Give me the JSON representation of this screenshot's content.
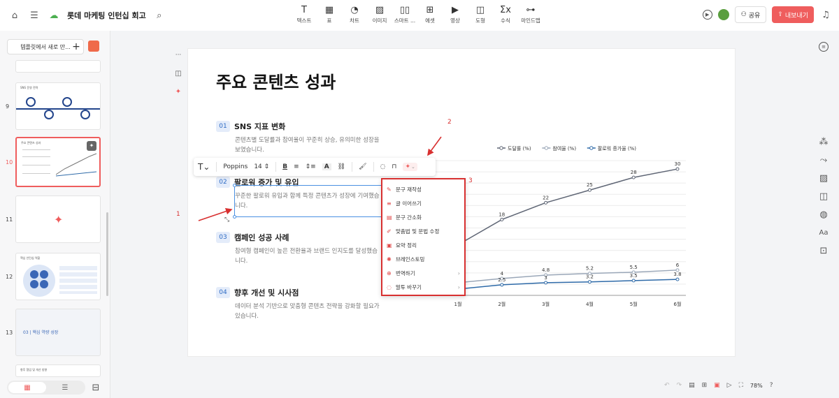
{
  "header": {
    "doc_title": "롯데 마케팅 인턴십 회고",
    "icons": [
      "home-icon",
      "menu-icon",
      "cloud-icon",
      "search-icon"
    ]
  },
  "toolbar": {
    "tools": [
      {
        "label": "텍스트",
        "icon": "T",
        "name": "tool-text"
      },
      {
        "label": "표",
        "icon": "▦",
        "name": "tool-table"
      },
      {
        "label": "차트",
        "icon": "◔",
        "name": "tool-chart"
      },
      {
        "label": "이미지",
        "icon": "▨",
        "name": "tool-image"
      },
      {
        "label": "스마트 ...",
        "icon": "▯▯",
        "name": "tool-smart"
      },
      {
        "label": "에셋",
        "icon": "⊞",
        "name": "tool-asset"
      },
      {
        "label": "영상",
        "icon": "▶",
        "name": "tool-video"
      },
      {
        "label": "도형",
        "icon": "◫",
        "name": "tool-shape"
      },
      {
        "label": "수식",
        "icon": "Σx",
        "name": "tool-formula"
      },
      {
        "label": "마인드맵",
        "icon": "⊶",
        "name": "tool-mindmap"
      }
    ],
    "share_label": "공유",
    "export_label": "내보내기"
  },
  "sidebar": {
    "template_button": "템플릿에서 새로 만...",
    "thumbs": [
      {
        "num": "9",
        "title": "SNS 운영 전략"
      },
      {
        "num": "10",
        "title": "주요 콘텐츠 성과"
      },
      {
        "num": "11",
        "title": ""
      },
      {
        "num": "12",
        "title": "핵심 인턴십 역할"
      },
      {
        "num": "13",
        "title": "03 | 핵심 역량 성장"
      },
      {
        "num": "",
        "title": "향후 협업 및 개선 방향"
      }
    ]
  },
  "slide": {
    "title": "주요 콘텐츠 성과",
    "sections": [
      {
        "num": "01",
        "heading": "SNS 지표 변화",
        "body": "콘텐츠별 도달률과 참여율이 꾸준히 상승, 유의미한 성장을 보였습니다."
      },
      {
        "num": "02",
        "heading": "팔로워 증가 및 유입",
        "body": "꾸준한 팔로워 유입과 함께 특정 콘텐츠가 성장에 기여했습니다."
      },
      {
        "num": "03",
        "heading": "캠페인 성공 사례",
        "body": "참여형 캠페인이 높은 전환율과 브랜드 인지도를 달성했습니다."
      },
      {
        "num": "04",
        "heading": "향후 개선 및 시사점",
        "body": "데이터 분석 기반으로 맞춤형 콘텐츠 전략을 강화할 필요가 있습니다."
      }
    ]
  },
  "chart_data": {
    "type": "line",
    "categories": [
      "1월",
      "2월",
      "3월",
      "4월",
      "5월",
      "6월"
    ],
    "series": [
      {
        "name": "도달률 (%)",
        "values": [
          12,
          18,
          22,
          25,
          28,
          30
        ],
        "color": "#5f6675"
      },
      {
        "name": "참여율 (%)",
        "values": [
          3.0,
          4.0,
          4.8,
          5.2,
          5.5,
          6.0
        ],
        "color": "#9aa7b8"
      },
      {
        "name": "팔로워 증가율 (%)",
        "values": [
          1.5,
          2.5,
          3.0,
          3.2,
          3.5,
          3.8
        ],
        "color": "#2e6aa8"
      }
    ],
    "data_labels": [
      {
        "series": 0,
        "index": 1,
        "text": "18"
      },
      {
        "series": 0,
        "index": 2,
        "text": "22"
      },
      {
        "series": 0,
        "index": 3,
        "text": "25"
      },
      {
        "series": 0,
        "index": 4,
        "text": "28"
      },
      {
        "series": 0,
        "index": 5,
        "text": "30"
      },
      {
        "series": 1,
        "index": 1,
        "text": "4"
      },
      {
        "series": 1,
        "index": 2,
        "text": "4.8"
      },
      {
        "series": 1,
        "index": 3,
        "text": "5.2"
      },
      {
        "series": 1,
        "index": 4,
        "text": "5.5"
      },
      {
        "series": 1,
        "index": 5,
        "text": "6"
      },
      {
        "series": 2,
        "index": 1,
        "text": "2.5"
      },
      {
        "series": 2,
        "index": 2,
        "text": "3"
      },
      {
        "series": 2,
        "index": 3,
        "text": "3.2"
      },
      {
        "series": 2,
        "index": 4,
        "text": "3.5"
      },
      {
        "series": 2,
        "index": 5,
        "text": "3.8"
      }
    ],
    "legend_position": "top",
    "grid": true,
    "ylim": [
      0,
      32
    ]
  },
  "format_bar": {
    "font": "Poppins",
    "size": "14",
    "icons": [
      "text-type-icon",
      "bold-icon",
      "align-icon",
      "line-spacing-icon",
      "text-color-icon",
      "link-icon",
      "format-painter-icon",
      "comment-icon",
      "lock-icon",
      "ai-sparkle-icon"
    ]
  },
  "ai_menu": {
    "items": [
      {
        "label": "문구 재작성",
        "icon": "✎",
        "submenu": false
      },
      {
        "label": "글 이어쓰기",
        "icon": "≡",
        "submenu": false
      },
      {
        "label": "문구 간소화",
        "icon": "▤",
        "submenu": false
      },
      {
        "label": "맞춤법 및 문법 수정",
        "icon": "✐",
        "submenu": false
      },
      {
        "label": "요약 정리",
        "icon": "▣",
        "submenu": false
      },
      {
        "label": "브레인스토밍",
        "icon": "✺",
        "submenu": false
      },
      {
        "label": "번역하기",
        "icon": "⊕",
        "submenu": true
      },
      {
        "label": "말투 바꾸기",
        "icon": "◌",
        "submenu": true
      }
    ]
  },
  "annotations": {
    "a1": "1",
    "a2": "2",
    "a3": "3"
  },
  "bottom": {
    "zoom": "78%"
  }
}
